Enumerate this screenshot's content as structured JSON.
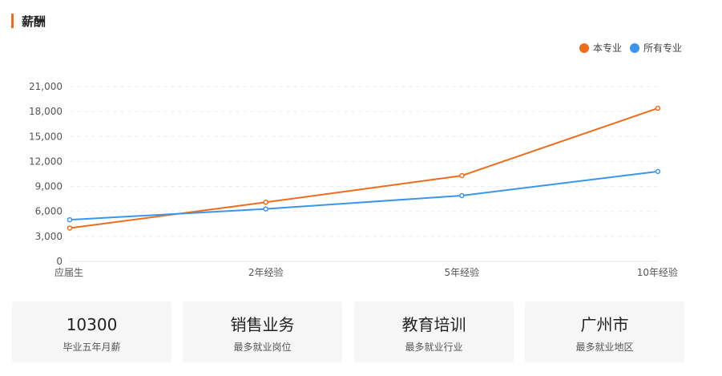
{
  "section": {
    "title": "薪酬"
  },
  "colors": {
    "accent": "#ef6c1a",
    "series_major": "#ef6c1a",
    "series_all": "#3b95eb"
  },
  "chart_data": {
    "type": "line",
    "categories": [
      "应届生",
      "2年经验",
      "5年经验",
      "10年经验"
    ],
    "series": [
      {
        "name": "本专业",
        "values": [
          4000,
          7100,
          10300,
          18400
        ]
      },
      {
        "name": "所有专业",
        "values": [
          5000,
          6300,
          7900,
          10800
        ]
      }
    ],
    "y_ticks": [
      "0",
      "3,000",
      "6,000",
      "9,000",
      "12,000",
      "15,000",
      "18,000",
      "21,000"
    ],
    "ylim": [
      0,
      21000
    ],
    "grid": true,
    "legend_position": "top-right"
  },
  "cards": [
    {
      "value": "10300",
      "label": "毕业五年月薪"
    },
    {
      "value": "销售业务",
      "label": "最多就业岗位"
    },
    {
      "value": "教育培训",
      "label": "最多就业行业"
    },
    {
      "value": "广州市",
      "label": "最多就业地区"
    }
  ]
}
